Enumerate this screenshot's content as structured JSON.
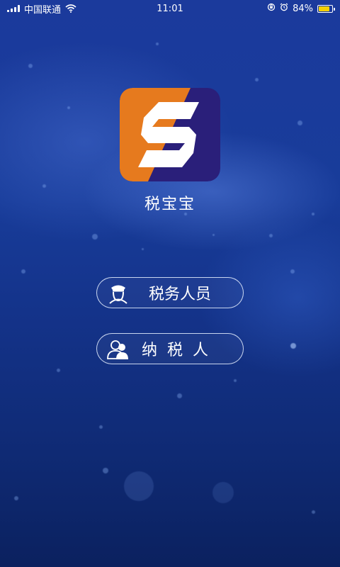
{
  "status_bar": {
    "carrier": "中国联通",
    "time": "11:01",
    "battery_percent": "84%",
    "battery_level": 0.84,
    "icons": [
      "signal-icon",
      "wifi-icon",
      "orientation-lock-icon",
      "alarm-icon",
      "battery-icon"
    ]
  },
  "app": {
    "name": "税宝宝",
    "logo_icon": "s-logo-icon",
    "colors": {
      "orange": "#e67a1e",
      "purple": "#2a1f7a",
      "background": "#183c9a"
    }
  },
  "roles": [
    {
      "label": "税务人员",
      "icon": "tax-officer-icon"
    },
    {
      "label": "纳税人",
      "icon": "taxpayer-icon"
    }
  ]
}
